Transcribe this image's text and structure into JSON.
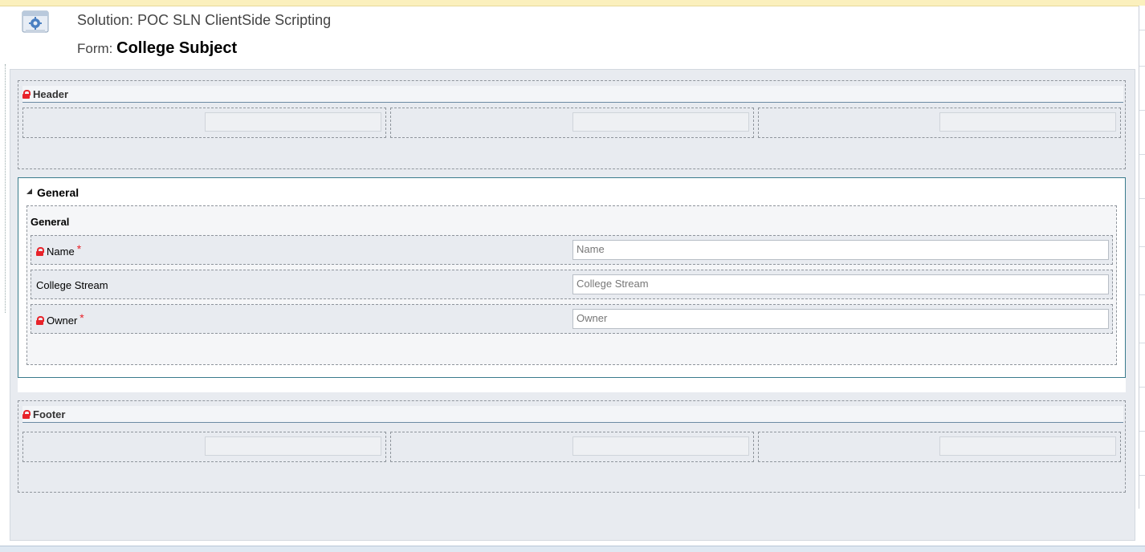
{
  "page": {
    "solution_label": "Solution:",
    "solution_name": "POC SLN ClientSide Scripting",
    "form_label": "Form:",
    "form_name": "College Subject",
    "app_icon": "form-gear-icon"
  },
  "header_band": {
    "title": "Header",
    "locked": true
  },
  "tab": {
    "title": "General",
    "expanded": true,
    "section": {
      "title": "General",
      "fields": [
        {
          "label": "Name",
          "required": true,
          "locked": true,
          "placeholder": "Name"
        },
        {
          "label": "College Stream",
          "required": false,
          "locked": false,
          "placeholder": "College Stream"
        },
        {
          "label": "Owner",
          "required": true,
          "locked": true,
          "placeholder": "Owner"
        }
      ]
    }
  },
  "footer_band": {
    "title": "Footer",
    "locked": true
  },
  "required_marker": "*",
  "colors": {
    "lock": "#e8232a",
    "tab_border": "#3a7b8c",
    "canvas": "#e8ebf0",
    "top_strip": "#fbf0bd"
  }
}
